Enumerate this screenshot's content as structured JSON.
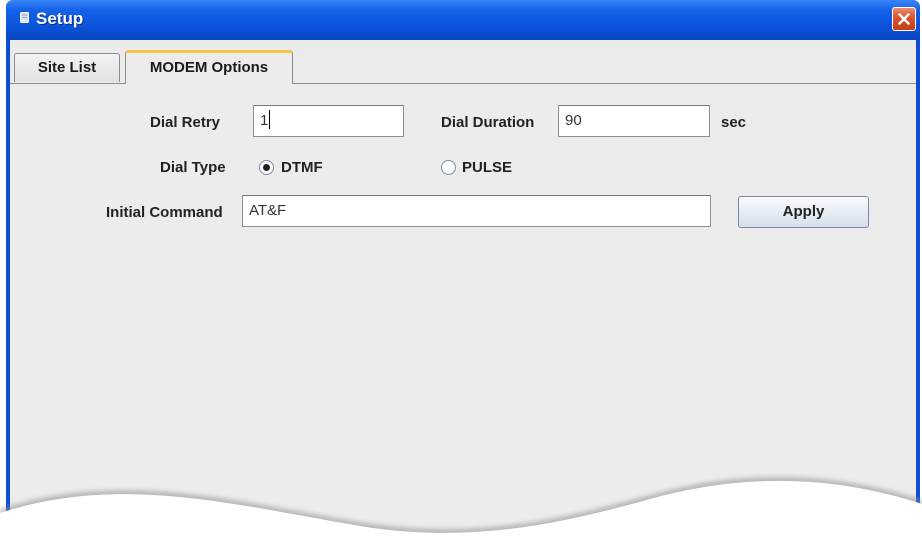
{
  "window": {
    "title": "Setup"
  },
  "tabs": [
    {
      "label": "Site List",
      "selected": false
    },
    {
      "label": "MODEM Options",
      "selected": true
    }
  ],
  "form": {
    "dial_retry_label": "Dial Retry",
    "dial_retry_value": "1",
    "dial_duration_label": "Dial Duration",
    "dial_duration_value": "90",
    "dial_duration_unit": "sec",
    "dial_type_label": "Dial Type",
    "dial_type_options": [
      {
        "label": "DTMF",
        "selected": true
      },
      {
        "label": "PULSE",
        "selected": false
      }
    ],
    "initial_command_label": "Initial Command",
    "initial_command_value": "AT&F",
    "apply_label": "Apply"
  },
  "icons": {
    "app": "window-app-icon",
    "close": "close-icon"
  },
  "colors": {
    "titlebar": "#0a52d9",
    "close_button": "#d8532b",
    "selected_tab_accent": "#f3c545",
    "panel_background": "#ececec"
  }
}
